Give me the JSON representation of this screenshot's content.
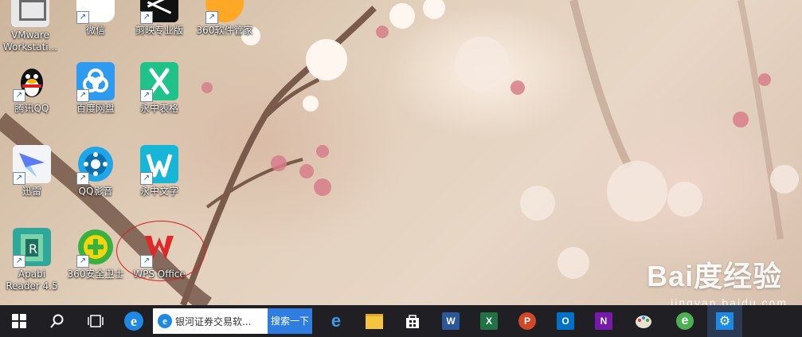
{
  "desktop": {
    "icons": [
      {
        "label_lines": [
          "VMware",
          "Workstati..."
        ],
        "icon": "vmware-icon"
      },
      {
        "label_lines": [
          "微信"
        ],
        "icon": "wechat-icon"
      },
      {
        "label_lines": [
          "剪映专业版"
        ],
        "icon": "jianying-icon"
      },
      {
        "label_lines": [
          "360软件管家"
        ],
        "icon": "360-software-manager-icon"
      },
      {
        "label_lines": [
          "腾讯QQ"
        ],
        "icon": "qq-icon"
      },
      {
        "label_lines": [
          "百度网盘"
        ],
        "icon": "baidu-netdisk-icon"
      },
      {
        "label_lines": [
          "永中表格"
        ],
        "icon": "yozo-sheet-icon"
      },
      {
        "label_lines": [
          "迅雷"
        ],
        "icon": "xunlei-icon"
      },
      {
        "label_lines": [
          "QQ影音"
        ],
        "icon": "qq-player-icon"
      },
      {
        "label_lines": [
          "永中文字"
        ],
        "icon": "yozo-writer-icon"
      },
      {
        "label_lines": [
          "Apabi",
          "Reader 4.5"
        ],
        "icon": "apabi-reader-icon"
      },
      {
        "label_lines": [
          "360安全卫士"
        ],
        "icon": "360-safe-icon"
      },
      {
        "label_lines": [
          "WPS Office"
        ],
        "icon": "wps-office-icon"
      }
    ]
  },
  "watermark": {
    "main": "Bai度经验",
    "sub": "jingyan.baidu.com"
  },
  "taskbar": {
    "search_text": "银河证券交易软...",
    "search_button": "搜索一下",
    "apps": [
      {
        "name": "word",
        "glyph": "W",
        "color": "#2b579a"
      },
      {
        "name": "excel",
        "glyph": "X",
        "color": "#217346"
      },
      {
        "name": "powerpoint",
        "glyph": "P",
        "color": "#d24726"
      },
      {
        "name": "outlook",
        "glyph": "O",
        "color": "#0072c6"
      },
      {
        "name": "onenote",
        "glyph": "N",
        "color": "#7719aa"
      }
    ]
  }
}
